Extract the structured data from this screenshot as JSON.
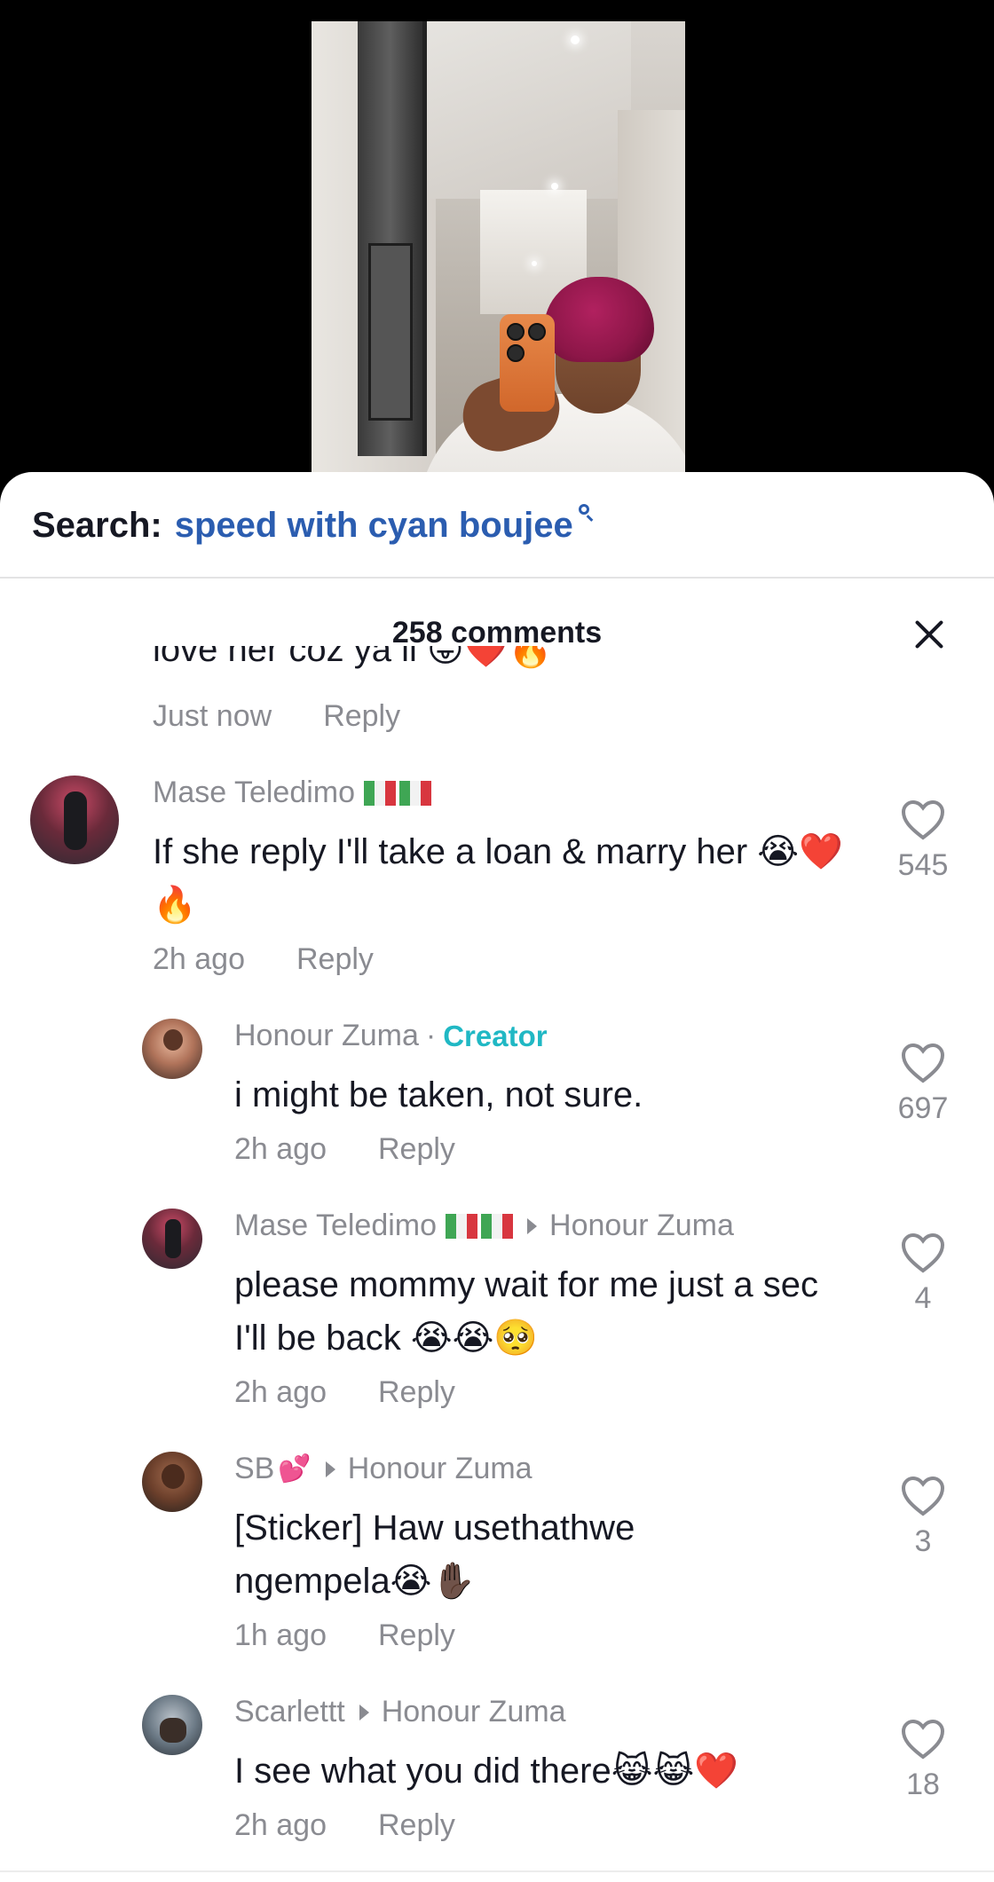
{
  "search": {
    "label": "Search:",
    "query": "speed with cyan boujee"
  },
  "sheet": {
    "title": "258 comments"
  },
  "partial_comment": {
    "text": "love her coz ya ll 😛❤️🔥",
    "time": "Just now",
    "reply": "Reply"
  },
  "comments": [
    {
      "name": "Mase Teledimo",
      "text": "If she reply I'll take a loan & marry her 😭❤️🔥",
      "time": "2h ago",
      "reply": "Reply",
      "likes": "545"
    },
    {
      "name": "Honour Zuma",
      "badge": "Creator",
      "text": "i might be taken, not sure.",
      "time": "2h ago",
      "reply": "Reply",
      "likes": "697"
    },
    {
      "name": "Mase Teledimo",
      "reply_to": "Honour Zuma",
      "text": "please mommy wait for me just a sec I'll be back 😭😭🥺",
      "time": "2h ago",
      "reply": "Reply",
      "likes": "4"
    },
    {
      "name": "SB",
      "reply_to": "Honour Zuma",
      "text": "[Sticker] Haw usethathwe ngempela😭✋🏿",
      "time": "1h ago",
      "reply": "Reply",
      "likes": "3"
    },
    {
      "name": "Scarlettt",
      "reply_to": "Honour Zuma",
      "text": "I see what you did there😹😹❤️",
      "time": "2h ago",
      "reply": "Reply",
      "likes": "18"
    }
  ],
  "colors": {
    "link": "#2b5db0",
    "creator": "#20b8c4",
    "muted": "#8a8b91",
    "text": "#161823"
  },
  "icons": {
    "like": "heart-outline-icon",
    "close": "close-icon",
    "search": "search-icon"
  }
}
